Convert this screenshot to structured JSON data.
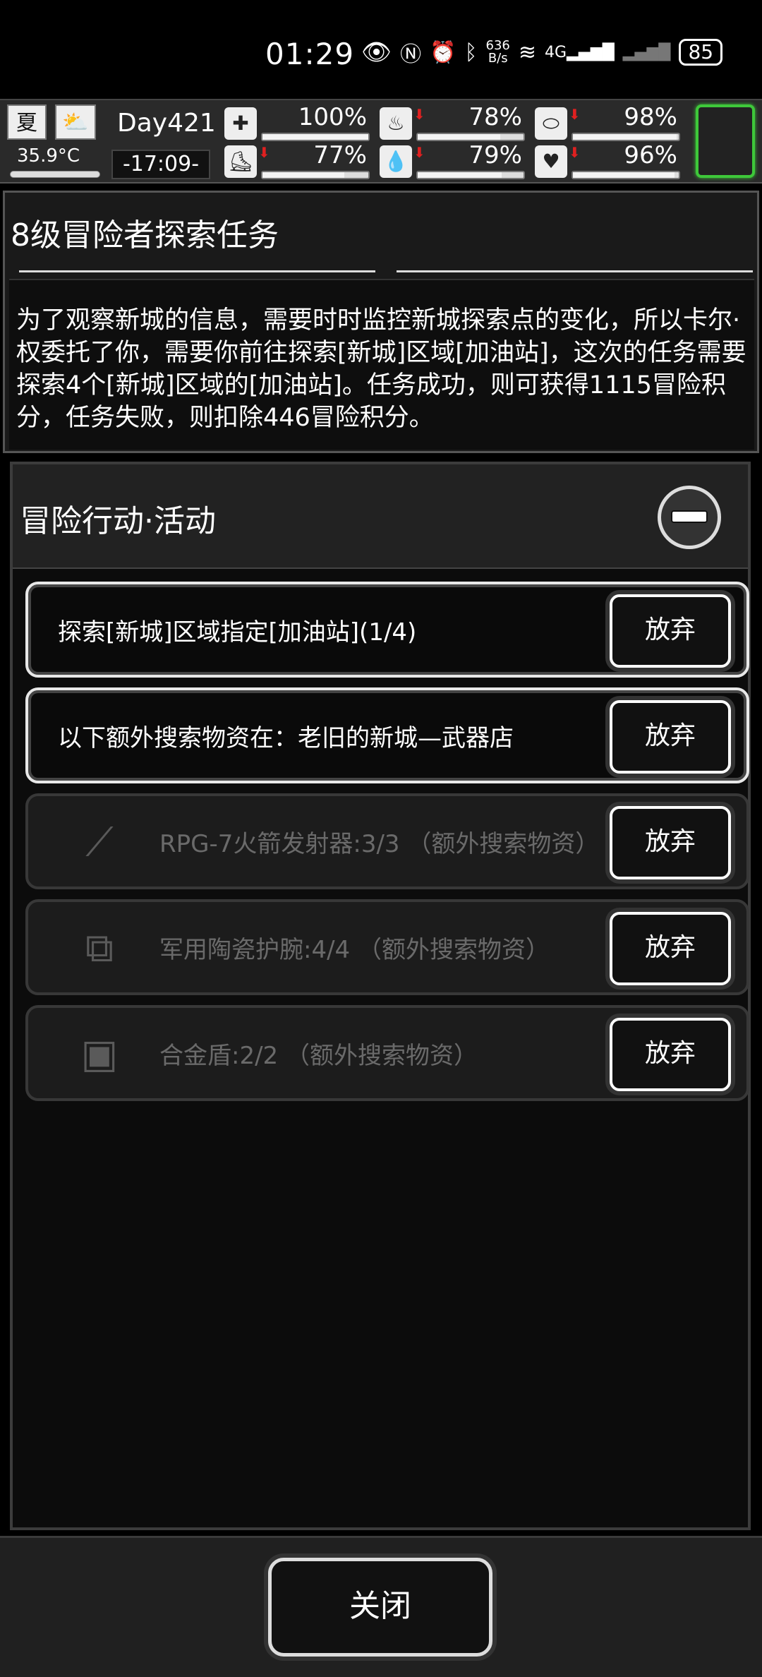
{
  "status_bar": {
    "time": "01:29",
    "net_speed_top": "636",
    "net_speed_bottom": "B/s",
    "network": "4G",
    "battery": "85"
  },
  "hud": {
    "season": "夏",
    "temperature": "35.9°C",
    "day": "Day421",
    "clock": "-17:09-",
    "stats": [
      {
        "name": "health",
        "value": "100%",
        "fill": 1.0,
        "icon": "medkit-icon",
        "down": false
      },
      {
        "name": "stomach",
        "value": "78%",
        "fill": 0.78,
        "icon": "stomach-icon",
        "down": true
      },
      {
        "name": "pill",
        "value": "98%",
        "fill": 0.98,
        "icon": "pill-icon",
        "down": true
      },
      {
        "name": "stamina",
        "value": "77%",
        "fill": 0.77,
        "icon": "boot-icon",
        "down": true
      },
      {
        "name": "water",
        "value": "79%",
        "fill": 0.79,
        "icon": "water-drop-icon",
        "down": true
      },
      {
        "name": "mood",
        "value": "96%",
        "fill": 0.96,
        "icon": "heart-icon",
        "down": true
      }
    ]
  },
  "mission": {
    "title": "8级冒险者探索任务",
    "description": "为了观察新城的信息，需要时时监控新城探索点的变化，所以卡尔·权委托了你，需要你前往探索[新城]区域[加油站]，这次的任务需要探索4个[新城]区域的[加油站]。任务成功，则可获得1115冒险积分，任务失败，则扣除446冒险积分。"
  },
  "activity": {
    "title": "冒险行动·活动",
    "tasks": [
      {
        "text": "探索[新城]区域指定[加油站](1/4)",
        "button": "放弃"
      },
      {
        "text": "以下额外搜索物资在：老旧的新城—武器店",
        "button": "放弃"
      },
      {
        "text": "RPG-7火箭发射器:3/3 （额外搜索物资）",
        "button": "放弃"
      },
      {
        "text": "军用陶瓷护腕:4/4 （额外搜索物资）",
        "button": "放弃"
      },
      {
        "text": "合金盾:2/2 （额外搜索物资）",
        "button": "放弃"
      }
    ]
  },
  "close_label": "关闭"
}
